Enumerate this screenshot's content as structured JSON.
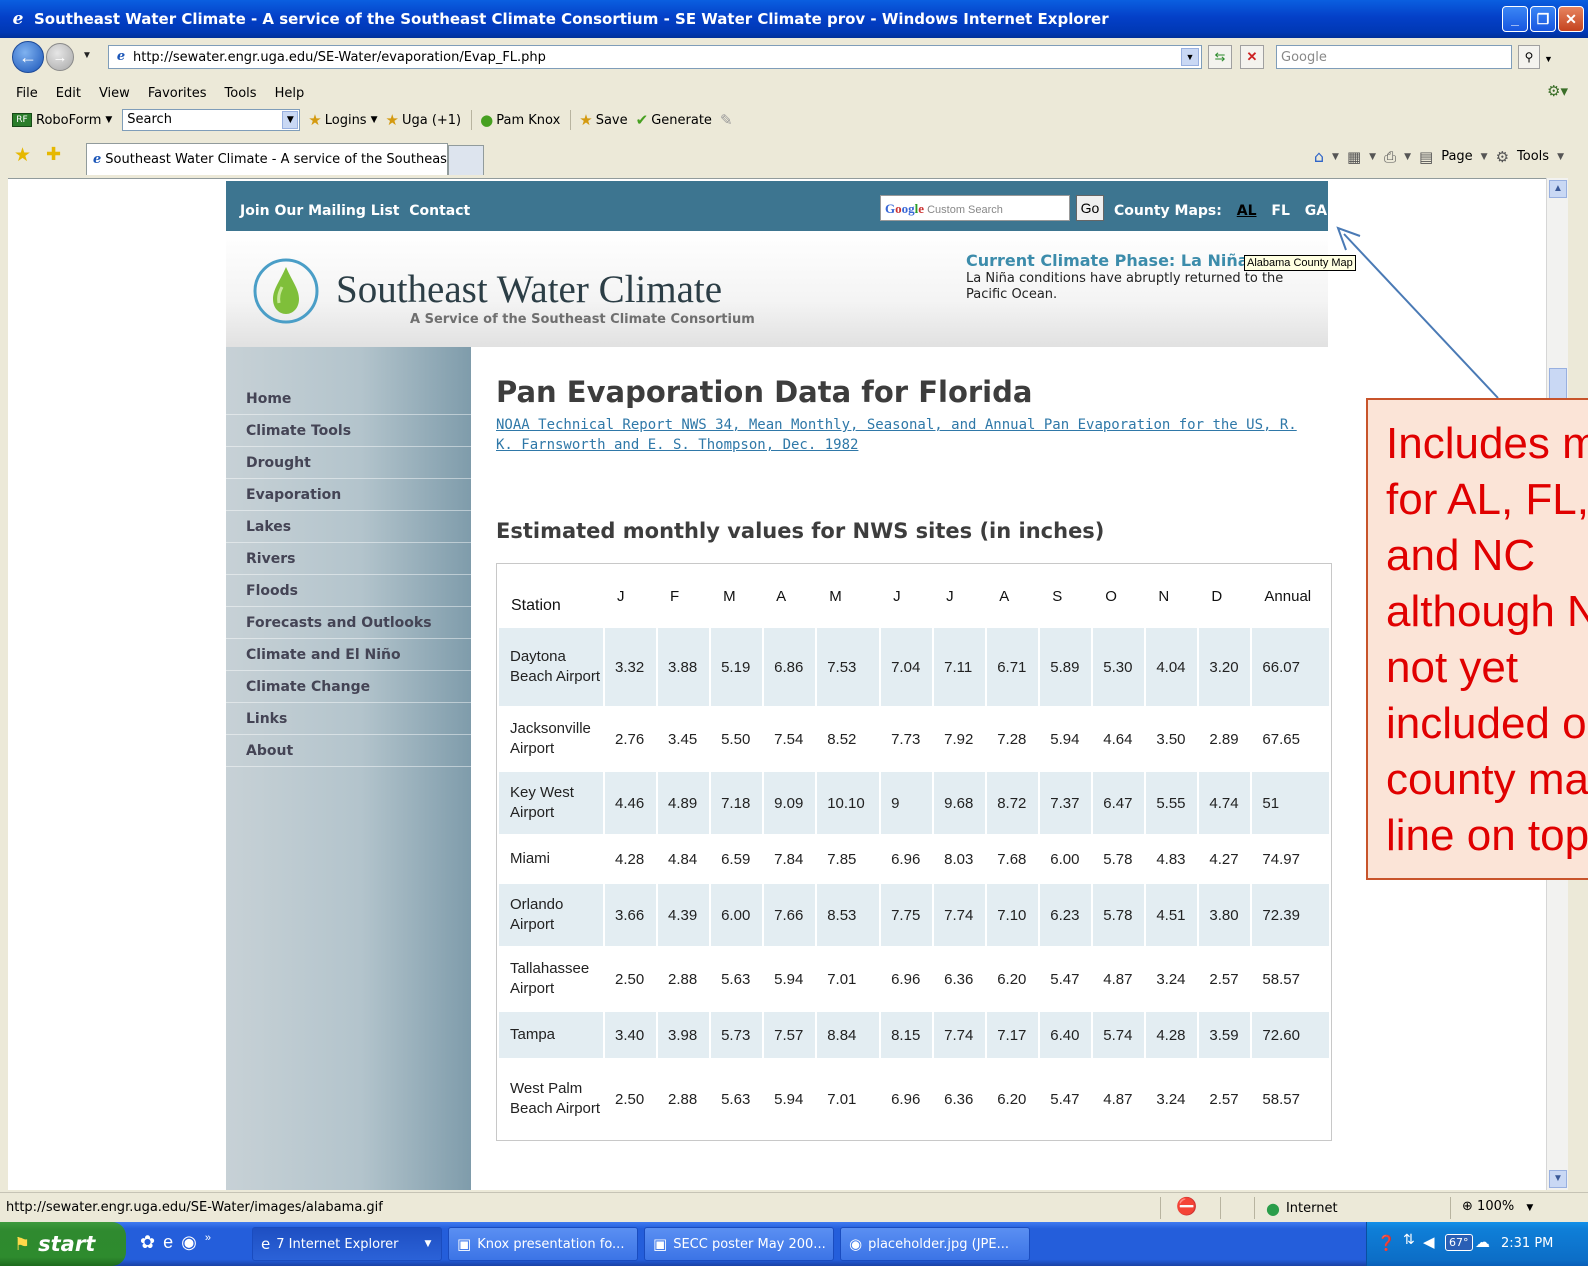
{
  "window": {
    "title": "Southeast Water Climate - A service of the Southeast Climate Consortium - SE Water Climate prov - Windows Internet Explorer",
    "min": "_",
    "max": "❐",
    "close": "✕"
  },
  "address": {
    "url": "http://sewater.engr.uga.edu/SE-Water/evaporation/Evap_FL.php",
    "search_placeholder": "Google"
  },
  "menu": [
    "File",
    "Edit",
    "View",
    "Favorites",
    "Tools",
    "Help"
  ],
  "linksbar": {
    "roboform": "RoboForm",
    "search_value": "Search",
    "links": [
      "Logins",
      "Uga (+1)",
      "Pam Knox",
      "Save",
      "Generate"
    ]
  },
  "tab": {
    "title": "Southeast Water Climate - A service of the Southeast...",
    "cmd_page": "Page",
    "cmd_tools": "Tools"
  },
  "site": {
    "join": "Join Our Mailing List",
    "contact": "Contact",
    "search_placeholder": "Custom Search",
    "go": "Go",
    "county_maps": "County Maps:",
    "states": [
      "AL",
      "FL",
      "GA"
    ],
    "name": "Southeast Water Climate",
    "tagline": "A Service of the Southeast Climate Consortium",
    "phase_title": "Current Climate Phase: La Niña",
    "phase_text": "La Niña conditions have abruptly returned to the Pacific Ocean.",
    "tooltip": "Alabama County Map",
    "nav": [
      "Home",
      "Climate Tools",
      "Drought",
      "Evaporation",
      "Lakes",
      "Rivers",
      "Floods",
      "Forecasts and Outlooks",
      "Climate and El Niño",
      "Climate Change",
      "Links",
      "About"
    ],
    "heading": "Pan Evaporation Data for Florida",
    "reference": "NOAA Technical Report NWS 34, Mean Monthly, Seasonal, and Annual Pan Evaporation for the US, R. K. Farnsworth and E. S. Thompson, Dec. 1982",
    "subheading": "Estimated monthly values for NWS sites (in inches)"
  },
  "table": {
    "headers": [
      "Station",
      "J",
      "F",
      "M",
      "A",
      "M",
      "J",
      "J",
      "A",
      "S",
      "O",
      "N",
      "D",
      "Annual"
    ],
    "rows": [
      [
        "Daytona Beach Airport",
        "3.32",
        "3.88",
        "5.19",
        "6.86",
        "7.53",
        "7.04",
        "7.11",
        "6.71",
        "5.89",
        "5.30",
        "4.04",
        "3.20",
        "66.07"
      ],
      [
        "Jacksonville Airport",
        "2.76",
        "3.45",
        "5.50",
        "7.54",
        "8.52",
        "7.73",
        "7.92",
        "7.28",
        "5.94",
        "4.64",
        "3.50",
        "2.89",
        "67.65"
      ],
      [
        "Key West Airport",
        "4.46",
        "4.89",
        "7.18",
        "9.09",
        "10.10",
        "9",
        "9.68",
        "8.72",
        "7.37",
        "6.47",
        "5.55",
        "4.74",
        "51"
      ],
      [
        "Miami",
        "4.28",
        "4.84",
        "6.59",
        "7.84",
        "7.85",
        "6.96",
        "8.03",
        "7.68",
        "6.00",
        "5.78",
        "4.83",
        "4.27",
        "74.97"
      ],
      [
        "Orlando Airport",
        "3.66",
        "4.39",
        "6.00",
        "7.66",
        "8.53",
        "7.75",
        "7.74",
        "7.10",
        "6.23",
        "5.78",
        "4.51",
        "3.80",
        "72.39"
      ],
      [
        "Tallahassee Airport",
        "2.50",
        "2.88",
        "5.63",
        "5.94",
        "7.01",
        "6.96",
        "6.36",
        "6.20",
        "5.47",
        "4.87",
        "3.24",
        "2.57",
        "58.57"
      ],
      [
        "Tampa",
        "3.40",
        "3.98",
        "5.73",
        "7.57",
        "8.84",
        "8.15",
        "7.74",
        "7.17",
        "6.40",
        "5.74",
        "4.28",
        "3.59",
        "72.60"
      ],
      [
        "West Palm Beach Airport",
        "2.50",
        "2.88",
        "5.63",
        "5.94",
        "7.01",
        "6.96",
        "6.36",
        "6.20",
        "5.47",
        "4.87",
        "3.24",
        "2.57",
        "58.57"
      ]
    ]
  },
  "callout": {
    "text": "Includes maps for AL, FL, GA and NC although NC is not yet included on the county maps line on top"
  },
  "status": {
    "url": "http://sewater.engr.uga.edu/SE-Water/images/alabama.gif",
    "zone": "Internet",
    "zoom": "100%"
  },
  "taskbar": {
    "start": "start",
    "buttons": [
      "7 Internet Explorer",
      "Knox presentation fo...",
      "SECC poster May 200...",
      "placeholder.jpg (JPE..."
    ],
    "temp": "67°",
    "clock": "2:31 PM"
  },
  "colors": {
    "site_nav": "#3d7590",
    "phase_accent": "#3c8cab",
    "callout_text": "#e00000",
    "callout_bg": "#fbe4d7",
    "arrow": "#4a7ab5"
  }
}
